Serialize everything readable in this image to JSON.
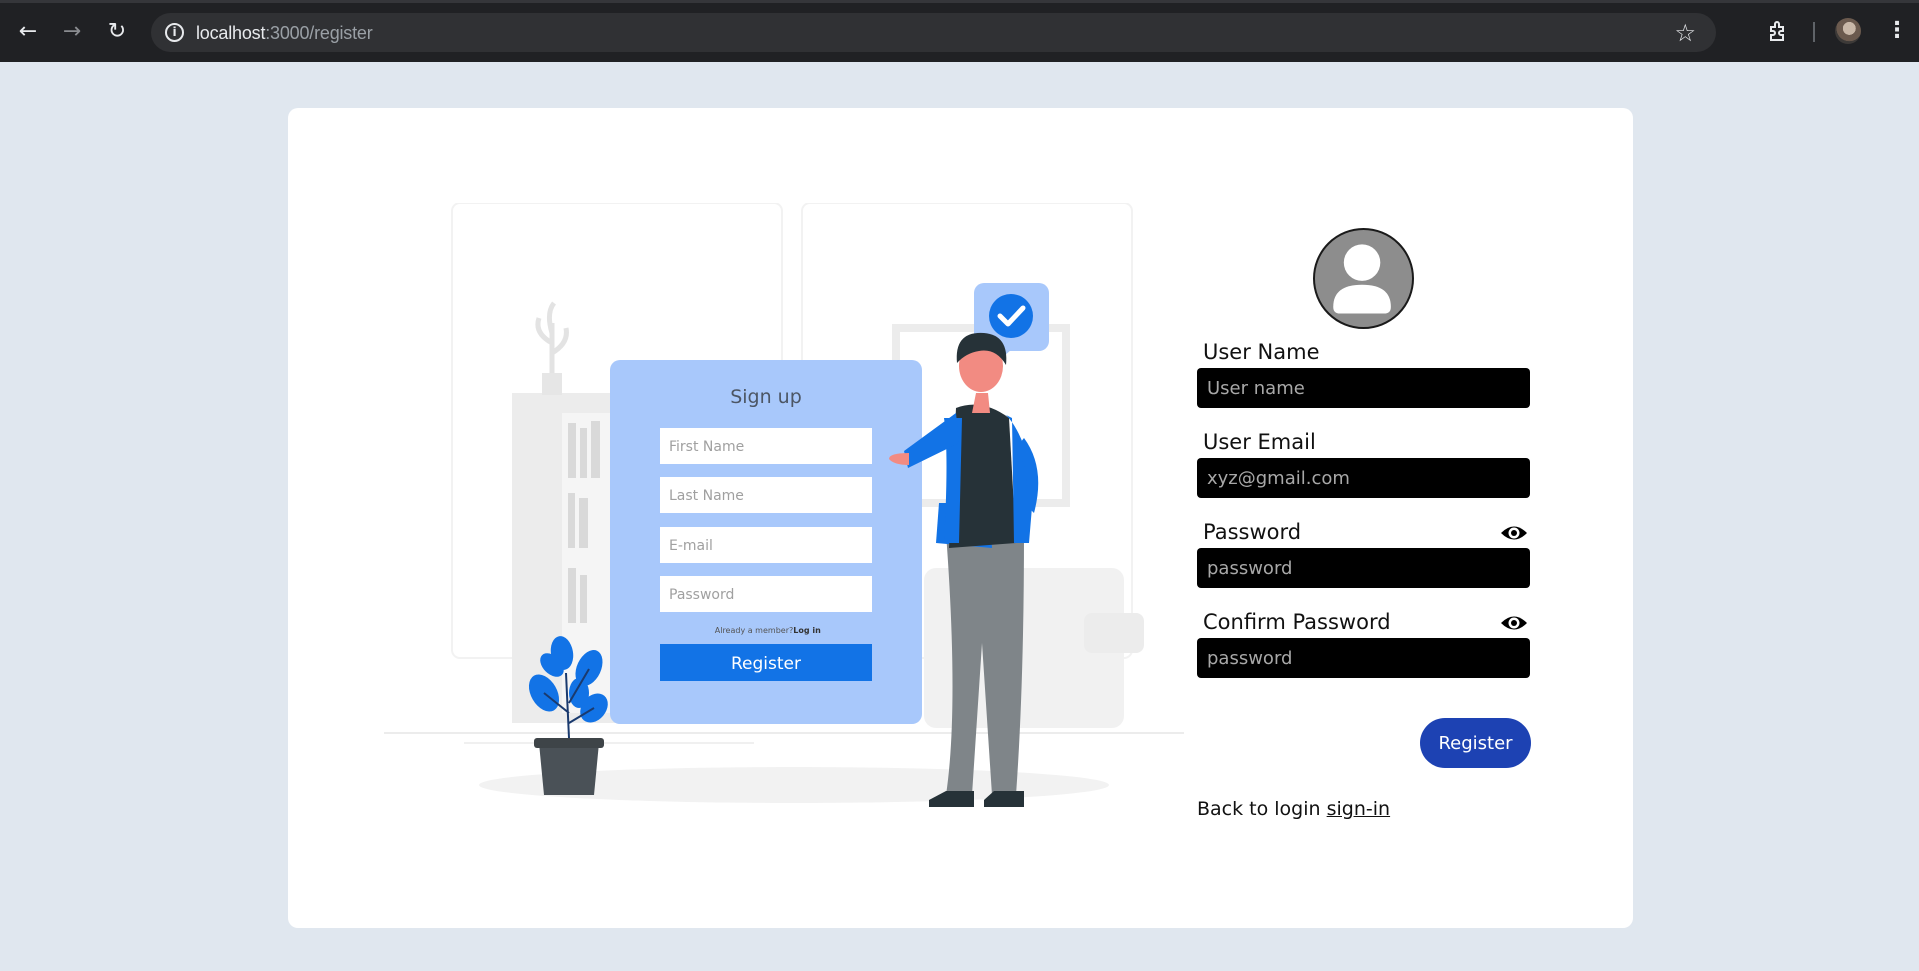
{
  "browser": {
    "url_host": "localhost",
    "url_rest": ":3000/register",
    "icons": [
      "back-arrow-icon",
      "forward-arrow-icon",
      "reload-icon",
      "info-icon",
      "star-icon",
      "extensions-icon",
      "profile-avatar",
      "menu-icon"
    ]
  },
  "illustration": {
    "card_title": "Sign up",
    "fields": [
      "First Name",
      "Last Name",
      "E-mail",
      "Password"
    ],
    "member_text": "Already a member?",
    "login_link": "Log in",
    "button": "Register"
  },
  "form": {
    "username": {
      "label": "User Name",
      "placeholder": "User name"
    },
    "email": {
      "label": "User Email",
      "placeholder": "xyz@gmail.com"
    },
    "password": {
      "label": "Password",
      "placeholder": "password"
    },
    "confirm": {
      "label": "Confirm Password",
      "placeholder": "password"
    },
    "register_label": "Register",
    "back_text": "Back to login",
    "signin_link": "sign-in"
  },
  "colors": {
    "page_bg": "#e0e7ef",
    "button": "#1d42b3",
    "illustration_accent": "#1273e6",
    "illustration_card": "#a8c8fb"
  }
}
